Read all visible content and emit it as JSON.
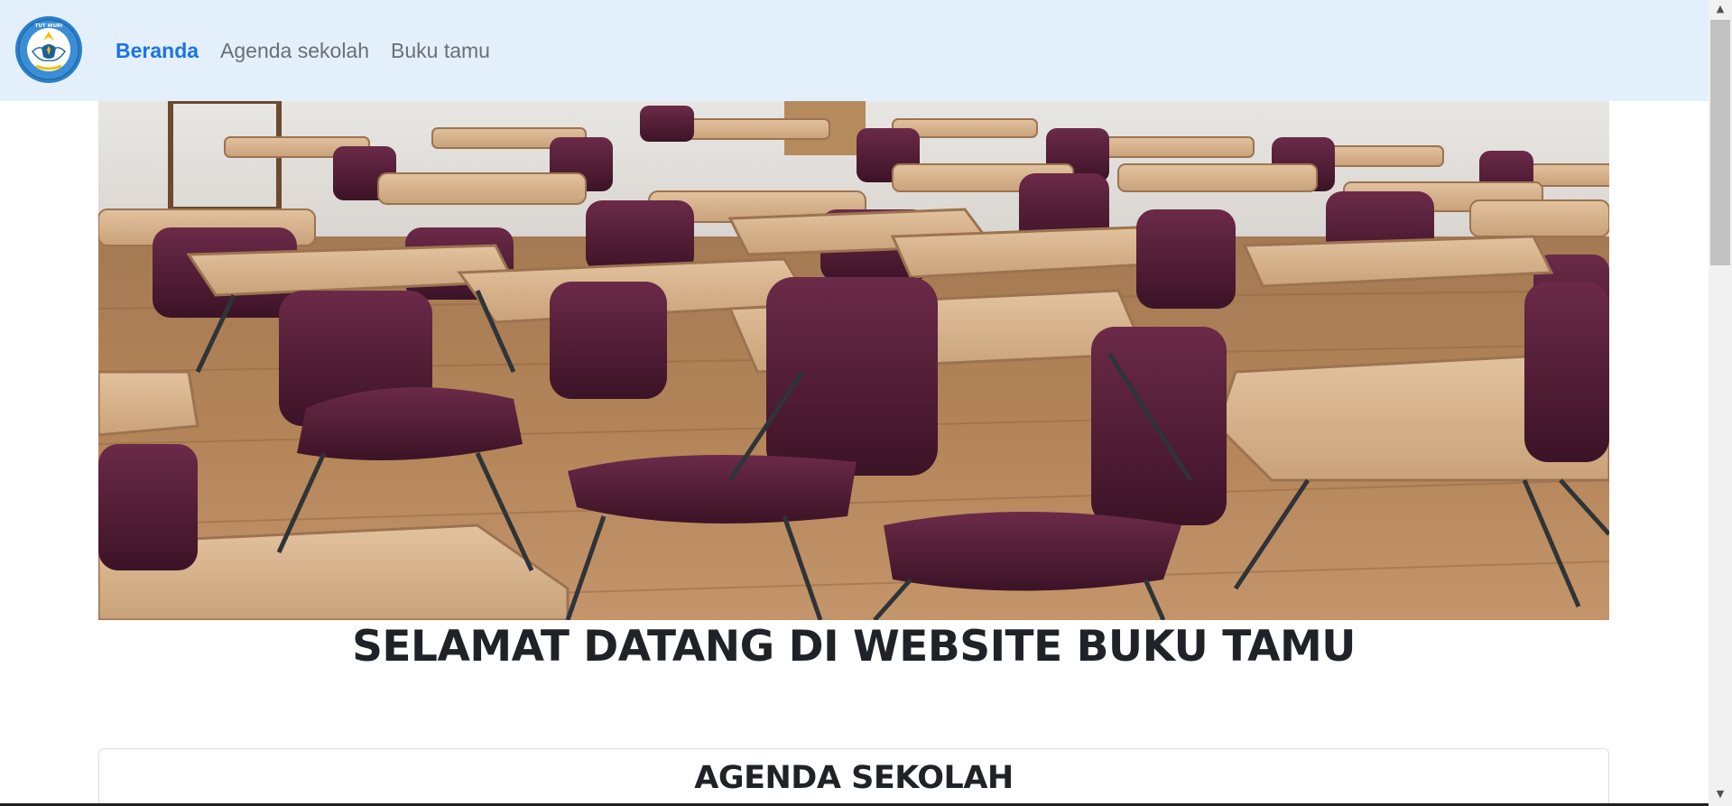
{
  "navbar": {
    "logo_icon": "tut-wuri-handayani-logo",
    "logo_text": "TUT WURI HANDAYANI",
    "links": [
      {
        "label": "Beranda",
        "active": true
      },
      {
        "label": "Agenda sekolah",
        "active": false
      },
      {
        "label": "Buku tamu",
        "active": false
      }
    ]
  },
  "hero": {
    "image": "classroom-desks-photo",
    "heading": "SELAMAT DATANG DI WEBSITE BUKU TAMU"
  },
  "agenda": {
    "title": "AGENDA SEKOLAH"
  },
  "colors": {
    "navbar_bg": "#e3f0fc",
    "active_link": "#1a73e8",
    "inactive_link": "#6b6f73",
    "heading": "#1f2327"
  },
  "scrollbar": {
    "up_icon": "scroll-up-arrow-icon",
    "down_icon": "scroll-down-arrow-icon"
  }
}
